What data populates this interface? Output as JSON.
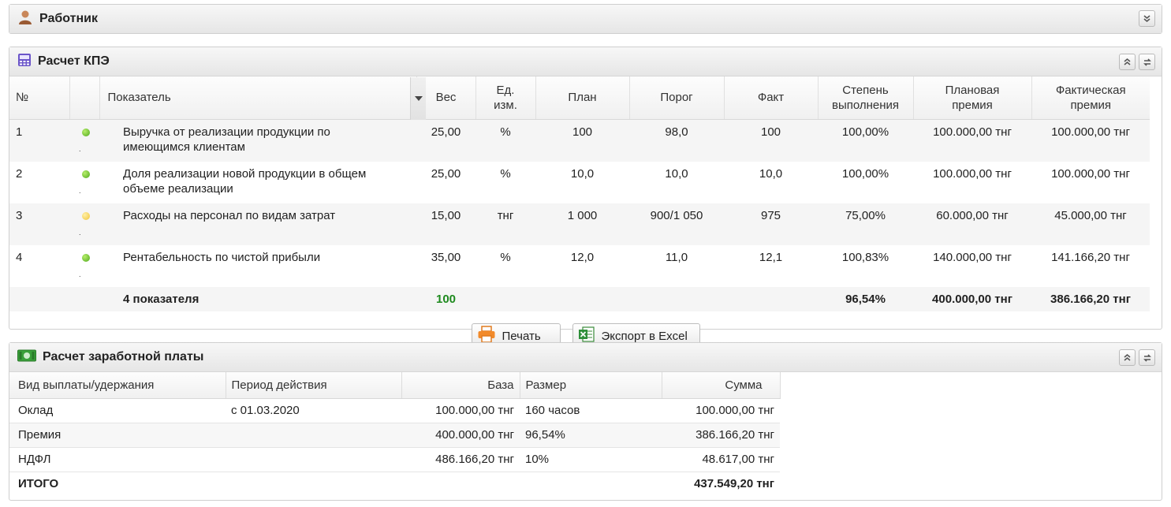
{
  "worker_panel": {
    "title": "Работник",
    "icon": "user-icon"
  },
  "kpi_panel": {
    "title": "Расчет КПЭ",
    "icon": "calculator-icon",
    "columns": {
      "num": "№",
      "indicator": "Показатель",
      "weight": "Вес",
      "unit_l1": "Ед.",
      "unit_l2": "изм.",
      "plan": "План",
      "threshold": "Порог",
      "fact": "Факт",
      "degree_l1": "Степень",
      "degree_l2": "выполнения",
      "planned_l1": "Плановая",
      "planned_l2": "премия",
      "actual_l1": "Фактическая",
      "actual_l2": "премия"
    },
    "rows": [
      {
        "num": "1",
        "status": "green",
        "mark": ".",
        "indicator_l1": "Выручка от реализации продукции по",
        "indicator_l2": "имеющимся клиентам",
        "weight": "25,00",
        "unit": "%",
        "plan": "100",
        "threshold": "98,0",
        "fact": "100",
        "degree": "100,00%",
        "planned": "100.000,00 тнг",
        "actual": "100.000,00 тнг"
      },
      {
        "num": "2",
        "status": "green",
        "mark": ".",
        "indicator_l1": "Доля реализации новой продукции в общем",
        "indicator_l2": "объеме реализации",
        "weight": "25,00",
        "unit": "%",
        "plan": "10,0",
        "threshold": "10,0",
        "fact": "10,0",
        "degree": "100,00%",
        "planned": "100.000,00 тнг",
        "actual": "100.000,00 тнг"
      },
      {
        "num": "3",
        "status": "yellow",
        "mark": ".",
        "indicator_l1": "Расходы на персонал по видам затрат",
        "indicator_l2": "",
        "weight": "15,00",
        "unit": "тнг",
        "plan": "1 000",
        "threshold": "900/1 050",
        "fact": "975",
        "degree": "75,00%",
        "planned": "60.000,00 тнг",
        "actual": "45.000,00 тнг"
      },
      {
        "num": "4",
        "status": "green",
        "mark": ".",
        "indicator_l1": "Рентабельность по чистой прибыли",
        "indicator_l2": "",
        "weight": "35,00",
        "unit": "%",
        "plan": "12,0",
        "threshold": "11,0",
        "fact": "12,1",
        "degree": "100,83%",
        "planned": "140.000,00 тнг",
        "actual": "141.166,20 тнг"
      }
    ],
    "total": {
      "label": "4 показателя",
      "weight": "100",
      "degree": "96,54%",
      "planned": "400.000,00 тнг",
      "actual": "386.166,20 тнг"
    },
    "buttons": {
      "print": "Печать",
      "export": "Экспорт в Excel"
    },
    "colors": {
      "status_green": "#5cb82a",
      "status_yellow": "#f2c94c",
      "weight_total": "#1e8a1e"
    }
  },
  "salary_panel": {
    "title": "Расчет заработной платы",
    "icon": "money-icon",
    "columns": {
      "type": "Вид выплаты/удержания",
      "period": "Период действия",
      "base": "База",
      "size": "Размер",
      "sum": "Сумма"
    },
    "rows": [
      {
        "type": "Оклад",
        "period": "с 01.03.2020",
        "base": "100.000,00 тнг",
        "size": "160 часов",
        "sum": "100.000,00 тнг"
      },
      {
        "type": "Премия",
        "period": "",
        "base": "400.000,00 тнг",
        "size": "96,54%",
        "sum": "386.166,20 тнг"
      },
      {
        "type": "НДФЛ",
        "period": "",
        "base": "486.166,20 тнг",
        "size": "10%",
        "sum": "48.617,00 тнг"
      }
    ],
    "total": {
      "label": "ИТОГО",
      "sum": "437.549,20 тнг"
    }
  }
}
